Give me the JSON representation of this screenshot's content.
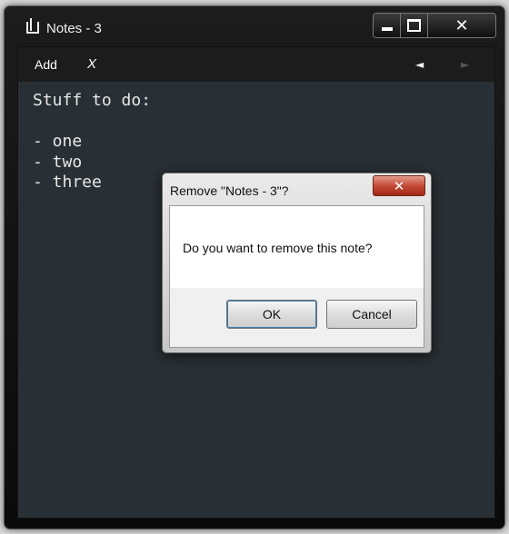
{
  "window": {
    "title": "Notes - 3",
    "caption": {
      "close_glyph": "✕"
    }
  },
  "toolbar": {
    "add_label": "Add",
    "delete_label": "X",
    "prev_label": "◄",
    "next_label": "►"
  },
  "note": {
    "text": "Stuff to do:\n\n- one\n- two\n- three"
  },
  "dialog": {
    "title": "Remove \"Notes - 3\"?",
    "close_glyph": "✕",
    "message": "Do you want to remove this note?",
    "ok_label": "OK",
    "cancel_label": "Cancel"
  },
  "colors": {
    "note_background": "#293035",
    "note_text": "#e6e6e6",
    "dialog_close_red": "#c24531"
  },
  "icons": [
    "note-app-icon",
    "minimize-icon",
    "maximize-icon",
    "close-icon",
    "previous-arrow-icon",
    "next-arrow-icon"
  ]
}
